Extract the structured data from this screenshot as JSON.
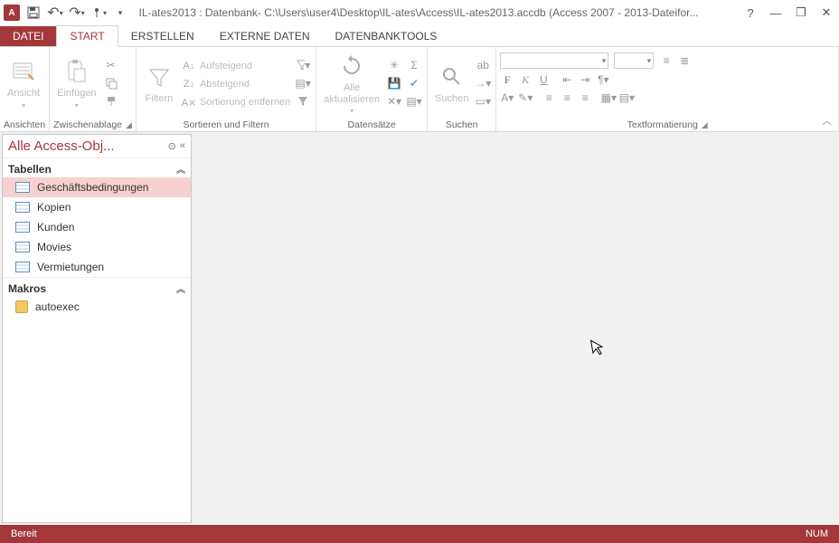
{
  "title": "IL-ates2013 : Datenbank- C:\\Users\\user4\\Desktop\\IL-ates\\Access\\IL-ates2013.accdb (Access 2007 - 2013-Dateifor...",
  "tabs": {
    "file": "DATEI",
    "start": "START",
    "erstellen": "ERSTELLEN",
    "externe": "EXTERNE DATEN",
    "tools": "DATENBANKTOOLS"
  },
  "groups": {
    "ansichten": {
      "label": "Ansichten",
      "ansicht": "Ansicht"
    },
    "zwischen": {
      "label": "Zwischenablage",
      "einfuegen": "Einfügen"
    },
    "sortfilter": {
      "label": "Sortieren und Filtern",
      "filtern": "Filtern",
      "aufsteigend": "Aufsteigend",
      "absteigend": "Absteigend",
      "entfernen": "Sortierung entfernen"
    },
    "datensaetze": {
      "label": "Datensätze",
      "aktualisieren": "Alle\naktualisieren"
    },
    "suchen": {
      "label": "Suchen",
      "suchen": "Suchen"
    },
    "textform": {
      "label": "Textformatierung"
    }
  },
  "nav": {
    "header": "Alle Access-Obj...",
    "section_tables": "Tabellen",
    "section_macros": "Makros",
    "tables": [
      "Geschäftsbedingungen",
      "Kopien",
      "Kunden",
      "Movies",
      "Vermietungen"
    ],
    "macros": [
      "autoexec"
    ]
  },
  "status": {
    "left": "Bereit",
    "right": "NUM"
  }
}
